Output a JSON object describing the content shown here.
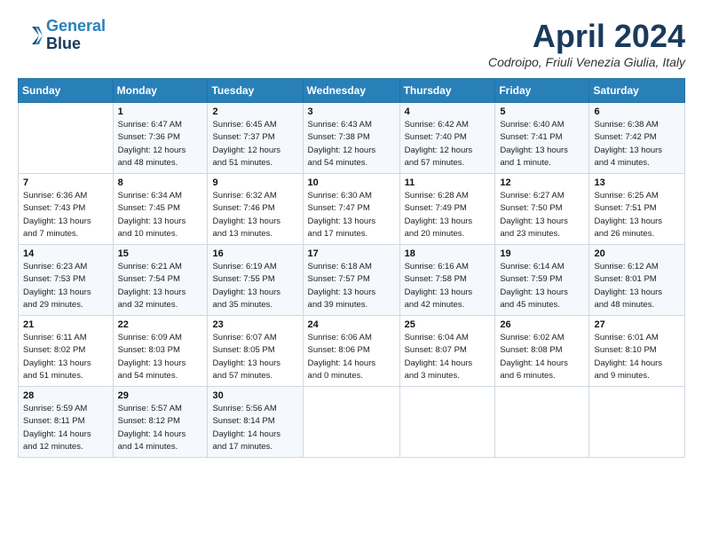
{
  "header": {
    "logo_line1": "General",
    "logo_line2": "Blue",
    "title": "April 2024",
    "subtitle": "Codroipo, Friuli Venezia Giulia, Italy"
  },
  "days_of_week": [
    "Sunday",
    "Monday",
    "Tuesday",
    "Wednesday",
    "Thursday",
    "Friday",
    "Saturday"
  ],
  "weeks": [
    [
      {
        "day": "",
        "info": ""
      },
      {
        "day": "1",
        "info": "Sunrise: 6:47 AM\nSunset: 7:36 PM\nDaylight: 12 hours\nand 48 minutes."
      },
      {
        "day": "2",
        "info": "Sunrise: 6:45 AM\nSunset: 7:37 PM\nDaylight: 12 hours\nand 51 minutes."
      },
      {
        "day": "3",
        "info": "Sunrise: 6:43 AM\nSunset: 7:38 PM\nDaylight: 12 hours\nand 54 minutes."
      },
      {
        "day": "4",
        "info": "Sunrise: 6:42 AM\nSunset: 7:40 PM\nDaylight: 12 hours\nand 57 minutes."
      },
      {
        "day": "5",
        "info": "Sunrise: 6:40 AM\nSunset: 7:41 PM\nDaylight: 13 hours\nand 1 minute."
      },
      {
        "day": "6",
        "info": "Sunrise: 6:38 AM\nSunset: 7:42 PM\nDaylight: 13 hours\nand 4 minutes."
      }
    ],
    [
      {
        "day": "7",
        "info": "Sunrise: 6:36 AM\nSunset: 7:43 PM\nDaylight: 13 hours\nand 7 minutes."
      },
      {
        "day": "8",
        "info": "Sunrise: 6:34 AM\nSunset: 7:45 PM\nDaylight: 13 hours\nand 10 minutes."
      },
      {
        "day": "9",
        "info": "Sunrise: 6:32 AM\nSunset: 7:46 PM\nDaylight: 13 hours\nand 13 minutes."
      },
      {
        "day": "10",
        "info": "Sunrise: 6:30 AM\nSunset: 7:47 PM\nDaylight: 13 hours\nand 17 minutes."
      },
      {
        "day": "11",
        "info": "Sunrise: 6:28 AM\nSunset: 7:49 PM\nDaylight: 13 hours\nand 20 minutes."
      },
      {
        "day": "12",
        "info": "Sunrise: 6:27 AM\nSunset: 7:50 PM\nDaylight: 13 hours\nand 23 minutes."
      },
      {
        "day": "13",
        "info": "Sunrise: 6:25 AM\nSunset: 7:51 PM\nDaylight: 13 hours\nand 26 minutes."
      }
    ],
    [
      {
        "day": "14",
        "info": "Sunrise: 6:23 AM\nSunset: 7:53 PM\nDaylight: 13 hours\nand 29 minutes."
      },
      {
        "day": "15",
        "info": "Sunrise: 6:21 AM\nSunset: 7:54 PM\nDaylight: 13 hours\nand 32 minutes."
      },
      {
        "day": "16",
        "info": "Sunrise: 6:19 AM\nSunset: 7:55 PM\nDaylight: 13 hours\nand 35 minutes."
      },
      {
        "day": "17",
        "info": "Sunrise: 6:18 AM\nSunset: 7:57 PM\nDaylight: 13 hours\nand 39 minutes."
      },
      {
        "day": "18",
        "info": "Sunrise: 6:16 AM\nSunset: 7:58 PM\nDaylight: 13 hours\nand 42 minutes."
      },
      {
        "day": "19",
        "info": "Sunrise: 6:14 AM\nSunset: 7:59 PM\nDaylight: 13 hours\nand 45 minutes."
      },
      {
        "day": "20",
        "info": "Sunrise: 6:12 AM\nSunset: 8:01 PM\nDaylight: 13 hours\nand 48 minutes."
      }
    ],
    [
      {
        "day": "21",
        "info": "Sunrise: 6:11 AM\nSunset: 8:02 PM\nDaylight: 13 hours\nand 51 minutes."
      },
      {
        "day": "22",
        "info": "Sunrise: 6:09 AM\nSunset: 8:03 PM\nDaylight: 13 hours\nand 54 minutes."
      },
      {
        "day": "23",
        "info": "Sunrise: 6:07 AM\nSunset: 8:05 PM\nDaylight: 13 hours\nand 57 minutes."
      },
      {
        "day": "24",
        "info": "Sunrise: 6:06 AM\nSunset: 8:06 PM\nDaylight: 14 hours\nand 0 minutes."
      },
      {
        "day": "25",
        "info": "Sunrise: 6:04 AM\nSunset: 8:07 PM\nDaylight: 14 hours\nand 3 minutes."
      },
      {
        "day": "26",
        "info": "Sunrise: 6:02 AM\nSunset: 8:08 PM\nDaylight: 14 hours\nand 6 minutes."
      },
      {
        "day": "27",
        "info": "Sunrise: 6:01 AM\nSunset: 8:10 PM\nDaylight: 14 hours\nand 9 minutes."
      }
    ],
    [
      {
        "day": "28",
        "info": "Sunrise: 5:59 AM\nSunset: 8:11 PM\nDaylight: 14 hours\nand 12 minutes."
      },
      {
        "day": "29",
        "info": "Sunrise: 5:57 AM\nSunset: 8:12 PM\nDaylight: 14 hours\nand 14 minutes."
      },
      {
        "day": "30",
        "info": "Sunrise: 5:56 AM\nSunset: 8:14 PM\nDaylight: 14 hours\nand 17 minutes."
      },
      {
        "day": "",
        "info": ""
      },
      {
        "day": "",
        "info": ""
      },
      {
        "day": "",
        "info": ""
      },
      {
        "day": "",
        "info": ""
      }
    ]
  ]
}
